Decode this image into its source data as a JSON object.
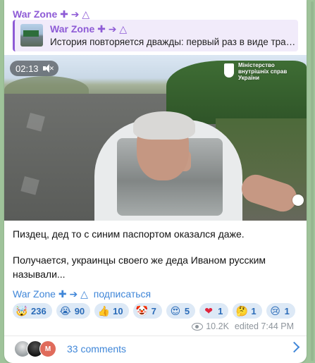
{
  "channel": {
    "name": "War Zone ✚ ➔ △"
  },
  "reply": {
    "author": "War Zone ✚ ➔ △",
    "text": "История повторяется дважды: первый раз в виде траге..."
  },
  "video": {
    "duration": "02:13",
    "ministry_lines": [
      "Міністерство",
      "внутрішніх справ",
      "України"
    ]
  },
  "message": {
    "paragraph1": "Пиздец, дед то с синим паспортом оказался даже.",
    "paragraph2": "Получается, украинцы своего же деда Иваном русским называли..."
  },
  "signature": {
    "channel": "War Zone ✚ ➔ △",
    "subscribe": "подписаться"
  },
  "reactions": [
    {
      "emoji": "🤯",
      "count": "236"
    },
    {
      "emoji": "😭",
      "count": "90"
    },
    {
      "emoji": "👍",
      "count": "10"
    },
    {
      "emoji": "🤡",
      "count": "7"
    },
    {
      "emoji": "😍",
      "count": "5"
    },
    {
      "emoji": "❤",
      "count": "1"
    },
    {
      "emoji": "🤔",
      "count": "1"
    },
    {
      "emoji": "😢",
      "count": "1"
    }
  ],
  "meta": {
    "views": "10.2K",
    "edited": "edited 7:44 PM"
  },
  "comments": {
    "label": "33 comments",
    "avatar_letter": "M"
  },
  "colors": {
    "accent": "#8e5bd6",
    "link": "#3f86d8",
    "chip_bg": "#dde9f6"
  }
}
